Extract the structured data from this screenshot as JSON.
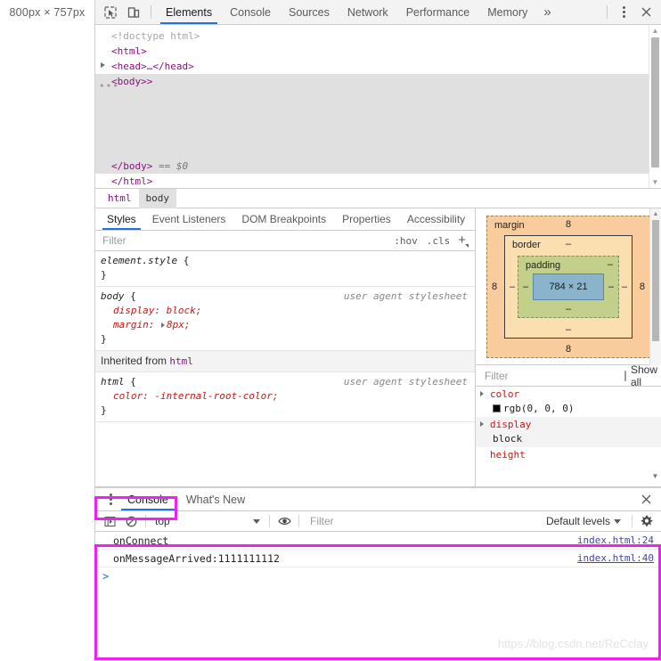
{
  "viewport_label": "800px × 757px",
  "toolbar": {
    "inspect_icon": "inspect-element-icon",
    "device_icon": "device-toolbar-icon",
    "more_tabs_label": "»",
    "kebab_icon": "more-options-icon",
    "close_icon": "close-icon",
    "tabs": [
      {
        "label": "Elements",
        "active": true
      },
      {
        "label": "Console",
        "active": false
      },
      {
        "label": "Sources",
        "active": false
      },
      {
        "label": "Network",
        "active": false
      },
      {
        "label": "Performance",
        "active": false
      },
      {
        "label": "Memory",
        "active": false
      }
    ]
  },
  "dom_tree": {
    "lines": [
      {
        "text": "<!doctype html>",
        "kind": "doctype",
        "indent": 1
      },
      {
        "text": "<html>",
        "kind": "tag",
        "indent": 1
      },
      {
        "text": "<head>…</head>",
        "kind": "collapsed",
        "indent": 2
      },
      {
        "text": "<body>>",
        "kind": "selected",
        "indent": 2
      },
      {
        "text": "</body> == $0",
        "kind": "closing-selected",
        "indent": 2
      },
      {
        "text": "</html>",
        "kind": "tag",
        "indent": 1
      }
    ],
    "doctype": "<!doctype html>",
    "html_open": "<html>",
    "head_collapsed": "<head>…</head>",
    "body_open": "<body>>",
    "body_close": "</body>",
    "selected_marker": "== $0",
    "html_close": "</html>"
  },
  "breadcrumb": {
    "items": [
      {
        "label": "html",
        "active": false
      },
      {
        "label": "body",
        "active": true
      }
    ]
  },
  "styles_panel": {
    "tabs": [
      {
        "label": "Styles",
        "active": true
      },
      {
        "label": "Event Listeners",
        "active": false
      },
      {
        "label": "DOM Breakpoints",
        "active": false
      },
      {
        "label": "Properties",
        "active": false
      },
      {
        "label": "Accessibility",
        "active": false
      }
    ],
    "filter_placeholder": "Filter",
    "filter_value": "",
    "hov_label": ":hov",
    "cls_label": ".cls",
    "new_rule_label": "+",
    "rules": [
      {
        "selector": "element.style",
        "origin": "",
        "declarations": []
      },
      {
        "selector": "body",
        "origin": "user agent stylesheet",
        "declarations": [
          {
            "prop": "display",
            "value": "block",
            "expandable": false
          },
          {
            "prop": "margin",
            "value": "8px",
            "expandable": true
          }
        ]
      }
    ],
    "inherited_label": "Inherited from",
    "inherited_from": "html",
    "inherited_rules": [
      {
        "selector": "html",
        "origin": "user agent stylesheet",
        "declarations": [
          {
            "prop": "color",
            "value": "-internal-root-color",
            "expandable": false
          }
        ]
      }
    ]
  },
  "box_model": {
    "margin_label": "margin",
    "border_label": "border",
    "padding_label": "padding",
    "content_size": "784 × 21",
    "margin": {
      "top": "8",
      "right": "8",
      "bottom": "8",
      "left": "8"
    },
    "border": {
      "top": "–",
      "right": "–",
      "bottom": "–",
      "left": "–"
    },
    "padding": {
      "top": "–",
      "right": "–",
      "bottom": "–",
      "left": "–"
    },
    "colors": {
      "margin": "#f9cc9d",
      "border": "#fbdfb0",
      "padding": "#c3d08b",
      "content": "#89b4cc"
    }
  },
  "computed": {
    "filter_placeholder": "Filter",
    "filter_value": "",
    "show_all_label": "Show all",
    "show_all_checked": false,
    "properties": [
      {
        "name": "color",
        "value": "rgb(0, 0, 0)",
        "swatch": "#000000"
      },
      {
        "name": "display",
        "value": "block",
        "swatch": ""
      },
      {
        "name": "height",
        "value": "",
        "swatch": ""
      }
    ]
  },
  "drawer": {
    "kebab_icon": "drawer-more-options-icon",
    "close_icon": "drawer-close-icon",
    "tabs": [
      {
        "label": "Console",
        "active": true
      },
      {
        "label": "What's New",
        "active": false
      }
    ],
    "toolbar": {
      "sidebar_icon": "console-sidebar-icon",
      "clear_icon": "clear-console-icon",
      "context": "top",
      "eye_icon": "live-expression-icon",
      "filter_placeholder": "Filter",
      "filter_value": "",
      "levels_label": "Default levels",
      "settings_icon": "settings-gear-icon"
    },
    "messages": [
      {
        "text": "onConnect",
        "source": "index.html:24"
      },
      {
        "text": "onMessageArrived:1111111112",
        "source": "index.html:40"
      }
    ],
    "prompt_symbol": ">"
  },
  "annotations": {
    "highlight_color": "#f020f0",
    "boxes": [
      {
        "name": "console-tab-highlight"
      },
      {
        "name": "console-output-highlight"
      }
    ]
  },
  "watermark": "https://blog.csdn.net/ReCclay"
}
